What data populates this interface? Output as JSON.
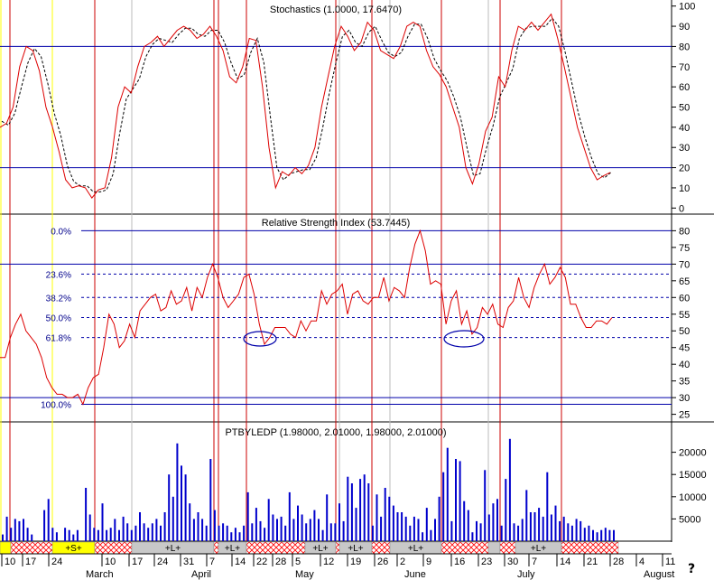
{
  "colors": {
    "price_red": "#dd0000",
    "signal": "#000000",
    "navy": "#00008b",
    "level_blue": "#0000aa",
    "cycle_red": "#cc0000",
    "gray": "#bbbbbb",
    "yellow": "#ffff00",
    "volume": "#0000cc",
    "hatch": "#ff0000",
    "segment_gray": "#c8c8c8"
  },
  "help_symbol": "?",
  "chart_data": [
    {
      "type": "line",
      "panel": "stochastic",
      "title": "Stochastics (1.0000, 17.6470)",
      "ylim": [
        -3,
        103
      ],
      "yticks": [
        0,
        10,
        20,
        30,
        40,
        50,
        60,
        70,
        80,
        90,
        100
      ],
      "levels": [
        20,
        80
      ],
      "series": [
        {
          "values": [
            40,
            42,
            50,
            70,
            80,
            78,
            68,
            50,
            40,
            28,
            14,
            10,
            11,
            10,
            5,
            9,
            10,
            25,
            50,
            60,
            57,
            70,
            80,
            82,
            85,
            80,
            84,
            88,
            90,
            88,
            84,
            86,
            90,
            85,
            78,
            65,
            62,
            70,
            84,
            83,
            60,
            30,
            10,
            18,
            16,
            20,
            17,
            21,
            30,
            50,
            65,
            80,
            90,
            85,
            78,
            82,
            92,
            88,
            78,
            76,
            74,
            80,
            90,
            92,
            90,
            78,
            70,
            66,
            60,
            50,
            40,
            20,
            12,
            22,
            38,
            45,
            65,
            60,
            78,
            90,
            88,
            92,
            88,
            92,
            96,
            84,
            70,
            55,
            40,
            30,
            20,
            14,
            16,
            17.6
          ]
        },
        {
          "values": [
            43,
            41,
            47,
            60,
            72,
            79,
            75,
            62,
            47,
            36,
            21,
            13,
            11,
            11,
            8,
            8,
            9,
            17,
            37,
            54,
            59,
            64,
            75,
            81,
            84,
            83,
            82,
            86,
            89,
            89,
            86,
            85,
            88,
            88,
            82,
            72,
            64,
            66,
            77,
            84,
            72,
            45,
            20,
            14,
            17,
            18,
            19,
            19,
            25,
            40,
            57,
            72,
            85,
            88,
            82,
            80,
            87,
            90,
            83,
            77,
            75,
            77,
            85,
            91,
            91,
            84,
            74,
            68,
            63,
            55,
            45,
            30,
            16,
            17,
            30,
            41,
            55,
            62,
            69,
            84,
            89,
            90,
            90,
            90,
            94,
            90,
            77,
            62,
            47,
            35,
            25,
            17,
            15,
            17.7
          ]
        }
      ]
    },
    {
      "type": "line",
      "panel": "rsi",
      "title": "Relative Strength Index (53.7445)",
      "ylim": [
        23,
        82
      ],
      "yticks": [
        25,
        30,
        35,
        40,
        45,
        50,
        55,
        60,
        65,
        70,
        75,
        80
      ],
      "levels": [
        30,
        70
      ],
      "fib_levels": [
        {
          "label": "0.0%",
          "value": 80
        },
        {
          "label": "23.6%",
          "value": 67
        },
        {
          "label": "38.2%",
          "value": 60
        },
        {
          "label": "50.0%",
          "value": 54
        },
        {
          "label": "61.8%",
          "value": 48
        },
        {
          "label": "100.0%",
          "value": 28
        }
      ],
      "series": [
        {
          "values": [
            42,
            42,
            48,
            52,
            55,
            50,
            48,
            46,
            42,
            36,
            33,
            31,
            31,
            30,
            30,
            31,
            28,
            33,
            36,
            37,
            45,
            55,
            52,
            45,
            47,
            52,
            48,
            56,
            58,
            60,
            61,
            56,
            57,
            62,
            58,
            59,
            63,
            56,
            63,
            60,
            66,
            70,
            66,
            60,
            57,
            59,
            61,
            66,
            67,
            61,
            52,
            46,
            48,
            51,
            51,
            51,
            49,
            48,
            53,
            50,
            53,
            53,
            62,
            58,
            61,
            62,
            64,
            55,
            61,
            62,
            59,
            58,
            60,
            60,
            66,
            59,
            63,
            62,
            60,
            69,
            76,
            80,
            74,
            64,
            65,
            64,
            52,
            59,
            62,
            52,
            56,
            49,
            51,
            57,
            55,
            58,
            52,
            51,
            57,
            59,
            66,
            60,
            57,
            63,
            67,
            70,
            64,
            66,
            69,
            66,
            58,
            58,
            54,
            51,
            51,
            53,
            53,
            52,
            54
          ]
        }
      ],
      "ellipses": [
        {
          "cx": 288,
          "cy": 375,
          "rx": 18,
          "ry": 8
        },
        {
          "cx": 514,
          "cy": 375,
          "rx": 22,
          "ry": 9
        }
      ]
    },
    {
      "type": "bar",
      "panel": "volume",
      "title": "PTBYLEDP (1.98000, 2.01000, 1.98000, 2.01000)",
      "ylim": [
        0,
        25000
      ],
      "yticks": [
        5000,
        10000,
        15000,
        20000
      ],
      "values": [
        1500,
        5500,
        3000,
        5000,
        4500,
        5000,
        3000,
        1500,
        0,
        0,
        7000,
        9500,
        3000,
        2000,
        0,
        3000,
        2500,
        1500,
        2500,
        0,
        12000,
        6000,
        3000,
        2500,
        8500,
        2500,
        3000,
        5000,
        2500,
        5500,
        4000,
        2500,
        3500,
        6500,
        4000,
        3000,
        4000,
        5000,
        3500,
        6500,
        15000,
        10000,
        22000,
        17000,
        15000,
        8500,
        5000,
        6500,
        5000,
        3500,
        18500,
        7000,
        3500,
        4000,
        3500,
        2000,
        3000,
        2000,
        3500,
        11000,
        4000,
        7500,
        4500,
        3000,
        9500,
        6000,
        5000,
        5500,
        3500,
        11000,
        5000,
        8000,
        6000,
        4000,
        5000,
        7000,
        5000,
        2500,
        10500,
        4000,
        4000,
        8500,
        4500,
        14500,
        13000,
        7500,
        14000,
        15000,
        13000,
        3500,
        10500,
        5500,
        12000,
        10000,
        8000,
        6500,
        6500,
        5500,
        3500,
        5500,
        5000,
        2000,
        7500,
        2500,
        5000,
        10000,
        15500,
        21000,
        4500,
        18500,
        18000,
        9000,
        7000,
        2000,
        4500,
        4000,
        16000,
        6000,
        8500,
        9500,
        3500,
        14000,
        23000,
        4000,
        3500,
        5000,
        11500,
        6500,
        6500,
        7500,
        5500,
        15500,
        6000,
        8000,
        4500,
        5500,
        4000,
        3500,
        5000,
        4500,
        3000,
        3500,
        2500,
        2000,
        2500,
        3000,
        2500,
        2500
      ]
    }
  ],
  "x_axis": {
    "days": [
      {
        "label": "10",
        "x": 5
      },
      {
        "label": "17",
        "x": 28
      },
      {
        "label": "24",
        "x": 57
      },
      {
        "label": "10",
        "x": 116
      },
      {
        "label": "17",
        "x": 146
      },
      {
        "label": "24",
        "x": 174
      },
      {
        "label": "31",
        "x": 203
      },
      {
        "label": "7",
        "x": 232
      },
      {
        "label": "14",
        "x": 260
      },
      {
        "label": "22",
        "x": 284
      },
      {
        "label": "28",
        "x": 305
      },
      {
        "label": "5",
        "x": 327
      },
      {
        "label": "12",
        "x": 358
      },
      {
        "label": "19",
        "x": 388
      },
      {
        "label": "26",
        "x": 418
      },
      {
        "label": "2",
        "x": 443
      },
      {
        "label": "9",
        "x": 472
      },
      {
        "label": "16",
        "x": 503
      },
      {
        "label": "23",
        "x": 533
      },
      {
        "label": "30",
        "x": 562
      },
      {
        "label": "7",
        "x": 589
      },
      {
        "label": "14",
        "x": 620
      },
      {
        "label": "21",
        "x": 650
      },
      {
        "label": "28",
        "x": 679
      },
      {
        "label": "4",
        "x": 708
      },
      {
        "label": "11",
        "x": 737
      }
    ],
    "months": [
      {
        "label": "March",
        "x": 95
      },
      {
        "label": "April",
        "x": 212
      },
      {
        "label": "May",
        "x": 327
      },
      {
        "label": "June",
        "x": 448
      },
      {
        "label": "July",
        "x": 573
      },
      {
        "label": "August",
        "x": 713
      }
    ]
  },
  "cycle_lines": [
    {
      "x": 11,
      "color": "red"
    },
    {
      "x": 105,
      "color": "red"
    },
    {
      "x": 237,
      "color": "red"
    },
    {
      "x": 242,
      "color": "red"
    },
    {
      "x": 273,
      "color": "red"
    },
    {
      "x": 372,
      "color": "red"
    },
    {
      "x": 412,
      "color": "red"
    },
    {
      "x": 489,
      "color": "red"
    },
    {
      "x": 554,
      "color": "red"
    },
    {
      "x": 622,
      "color": "red"
    },
    {
      "x": 1,
      "color": "yellow"
    },
    {
      "x": 58,
      "color": "yellow"
    },
    {
      "x": 146,
      "color": "gray"
    },
    {
      "x": 376,
      "color": "gray"
    },
    {
      "x": 432,
      "color": "gray"
    },
    {
      "x": 541,
      "color": "gray"
    }
  ],
  "segments": [
    {
      "x0": 0,
      "x1": 12,
      "kind": "yellow",
      "label": ""
    },
    {
      "x0": 12,
      "x1": 58,
      "kind": "hatch",
      "label": ""
    },
    {
      "x0": 58,
      "x1": 105,
      "kind": "yellow",
      "label": "+S+"
    },
    {
      "x0": 105,
      "x1": 146,
      "kind": "hatch",
      "label": ""
    },
    {
      "x0": 146,
      "x1": 237,
      "kind": "gray",
      "label": "+L+"
    },
    {
      "x0": 237,
      "x1": 242,
      "kind": "hatch",
      "label": ""
    },
    {
      "x0": 242,
      "x1": 273,
      "kind": "gray",
      "label": "+L+"
    },
    {
      "x0": 273,
      "x1": 338,
      "kind": "hatch",
      "label": ""
    },
    {
      "x0": 338,
      "x1": 372,
      "kind": "gray",
      "label": "+L+"
    },
    {
      "x0": 372,
      "x1": 376,
      "kind": "hatch",
      "label": ""
    },
    {
      "x0": 376,
      "x1": 412,
      "kind": "gray",
      "label": "+L+"
    },
    {
      "x0": 412,
      "x1": 432,
      "kind": "hatch",
      "label": ""
    },
    {
      "x0": 432,
      "x1": 489,
      "kind": "gray",
      "label": "+L+"
    },
    {
      "x0": 489,
      "x1": 541,
      "kind": "hatch",
      "label": ""
    },
    {
      "x0": 541,
      "x1": 554,
      "kind": "gray",
      "label": ""
    },
    {
      "x0": 554,
      "x1": 571,
      "kind": "hatch",
      "label": ""
    },
    {
      "x0": 571,
      "x1": 622,
      "kind": "gray",
      "label": "+L+"
    },
    {
      "x0": 622,
      "x1": 685,
      "kind": "hatch",
      "label": ""
    }
  ]
}
